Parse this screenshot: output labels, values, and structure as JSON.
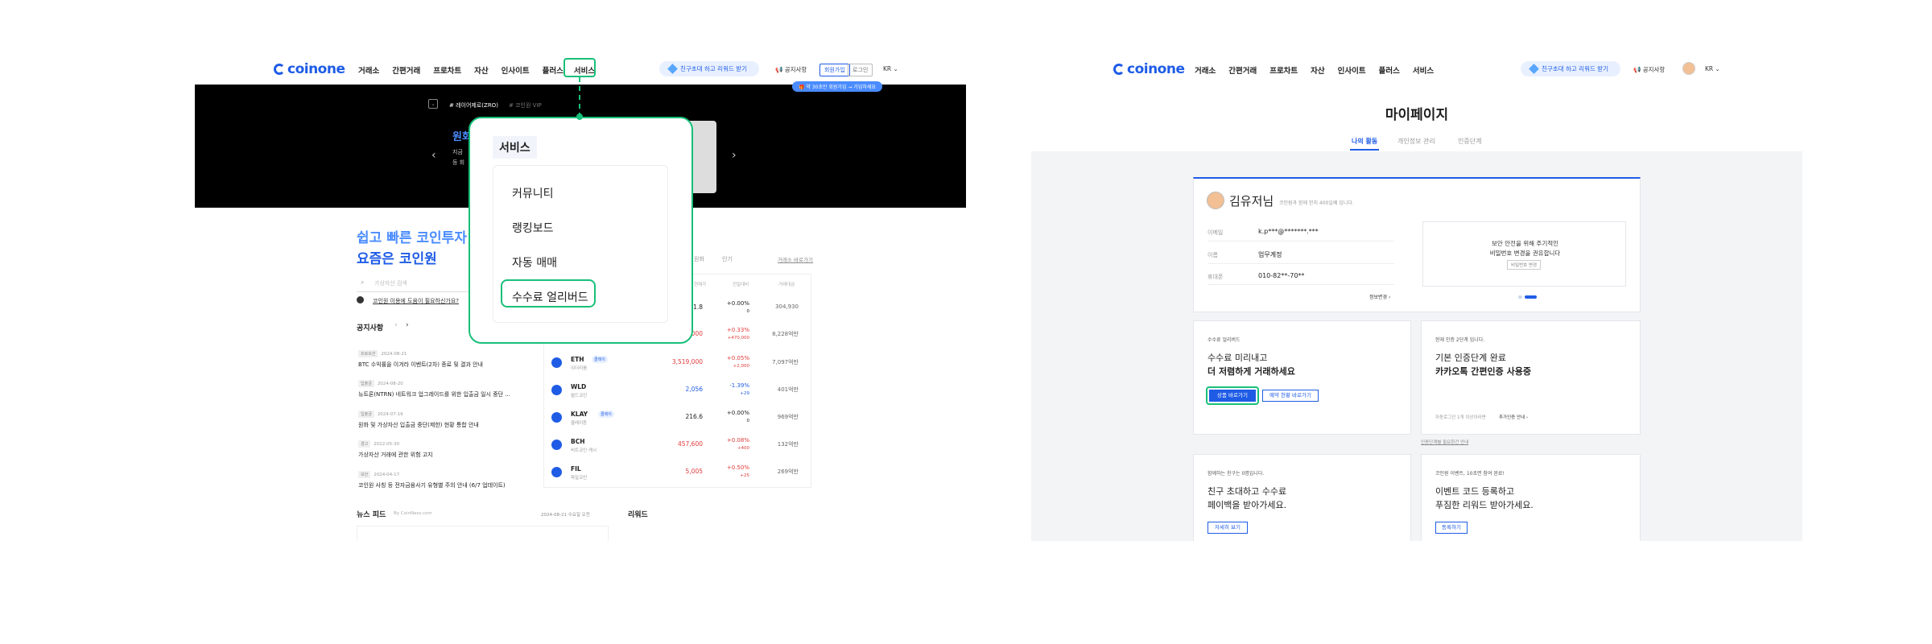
{
  "left": {
    "logo": "coinone",
    "nav": [
      "거래소",
      "간편거래",
      "프로차트",
      "자산",
      "인사이트",
      "플러스",
      "서비스"
    ],
    "invite_pill": "친구초대 하고 리워드 받기",
    "notice": "공지사항",
    "signup": "회원가입",
    "login": "로그인",
    "lang": "KR ⌄",
    "tooltip": "🎁 약 30초만 회원가입 → 가입하세요",
    "banner_tabs": [
      "# 레이어제로(ZRO)",
      "# 코인원 VIP"
    ],
    "banner_title": "원화",
    "banner_lines": [
      "지금 ",
      "등 회"
    ],
    "menu_title": "서비스",
    "menu_items": [
      "커뮤니티",
      "랭킹보드",
      "자동 매매",
      "수수료 얼리버드"
    ],
    "hero_1": "쉽고 빠른 코인투자",
    "hero_2": "요즘은 코인원",
    "search_placeholder": "가상자산 검색",
    "help_link": "코인원 이용에 도움이 필요하신가요?",
    "notice_title": "공지사항",
    "notices": [
      {
        "tag": "프로모션",
        "date": "2024-08-21",
        "title": "BTC 수익률을 이겨라 이벤트(2차) 종료 및 결과 안내"
      },
      {
        "tag": "입출금",
        "date": "2024-08-20",
        "title": "뉴트론(NTRN) 네트워크 업그레이드를 위한 입출금 일시 중단 ..."
      },
      {
        "tag": "입출금",
        "date": "2024-07-16",
        "title": "원화 및 가상자산 입출금 중단(제한) 현황 통합 안내"
      },
      {
        "tag": "경고",
        "date": "2022-05-30",
        "title": "가상자산 거래에 관한 위험 고지"
      },
      {
        "tag": "보안",
        "date": "2024-04-17",
        "title": "코인원 사칭 등 전자금융사기 유형별 주의 안내 (6/7 업데이트)"
      }
    ],
    "market_tabs": [
      "원화",
      "인기"
    ],
    "market_link": "거래소 바로가기",
    "market_headers": [
      "현재가",
      "전일대비",
      "거래대금"
    ],
    "coins": [
      {
        "sym": "",
        "nm": "",
        "price": "41.8",
        "chg": "+0.00%",
        "chg2": "0",
        "vol": "304,930",
        "color": "dark"
      },
      {
        "sym": "",
        "nm": "",
        "price": "000",
        "chg": "+0.33%",
        "chg2": "+470,000",
        "vol": "8,228억만",
        "color": "red"
      },
      {
        "sym": "ETH",
        "nm": "이더리움",
        "badge": "클레이",
        "price": "3,519,000",
        "chg": "+0.05%",
        "chg2": "+2,000",
        "vol": "7,097억만",
        "color": "red"
      },
      {
        "sym": "WLD",
        "nm": "월드코인",
        "price": "2,056",
        "chg": "-1.39%",
        "chg2": "+29",
        "vol": "401억만",
        "color": "blue"
      },
      {
        "sym": "KLAY",
        "nm": "클레이튼",
        "badge": "클레이",
        "price": "216.6",
        "chg": "+0.00%",
        "chg2": "0",
        "vol": "969억만",
        "color": "dark"
      },
      {
        "sym": "BCH",
        "nm": "비트코인 캐시",
        "price": "457,600",
        "chg": "+0.08%",
        "chg2": "+400",
        "vol": "132억만",
        "color": "red"
      },
      {
        "sym": "FIL",
        "nm": "파일코인",
        "price": "5,005",
        "chg": "+0.50%",
        "chg2": "+25",
        "vol": "269억만",
        "color": "red"
      }
    ],
    "news_title": "뉴스 피드",
    "news_source": "By CoinNess.com",
    "news_date": "2024-08-21 수요일 오전",
    "reward_title": "리워드"
  },
  "right": {
    "logo": "coinone",
    "nav": [
      "거래소",
      "간편거래",
      "프로차트",
      "자산",
      "인사이트",
      "플러스",
      "서비스"
    ],
    "invite_pill": "친구초대 하고 리워드 받기",
    "notice": "공지사항",
    "lang": "KR ⌄",
    "page_title": "마이페이지",
    "tabs": [
      "나의 활동",
      "개인정보 관리",
      "인증단계"
    ],
    "user_name": "김유저님",
    "user_sub": "코인원과 함께 한지 400일째 입니다.",
    "info": [
      {
        "label": "이메일",
        "value": "k.p***@*******.***"
      },
      {
        "label": "이름",
        "value": "업무계정"
      },
      {
        "label": "휴대폰",
        "value": "010-82**-70**"
      }
    ],
    "info_link": "정보변경 ›",
    "security_1": "보안 안전을 위해 주기적인",
    "security_2": "비밀번호 변경을 권유합니다",
    "security_btn": "비밀번호 변경",
    "fee_small": "수수료 얼리버드",
    "fee_1": "수수료 미리내고",
    "fee_2": "더 저렴하게 거래하세요",
    "fee_btn_1": "상품 바로가기",
    "fee_btn_2": "예약 현황 바로가기",
    "auth_small": "현재 인증 2단계 입니다.",
    "auth_1": "기본 인증단계 완료",
    "auth_2": "카카오톡 간편인증 사용중",
    "auth_note": "자동로그인 1개 이상이라면",
    "auth_link": "추가인증 안내 ›",
    "auth_under": "인증단계별 필요한건 안내",
    "friend_small": "함께하는 친구는 0명입니다.",
    "friend_1": "친구 초대하고 수수료",
    "friend_2": "페이백을 받아가세요.",
    "friend_btn": "자세히 보기",
    "event_small": "코인원 이벤트, 10초면 참여 완료!",
    "event_1": "이벤트 코드 등록하고",
    "event_2": "푸짐한 리워드 받아가세요.",
    "event_btn": "등록하기"
  }
}
